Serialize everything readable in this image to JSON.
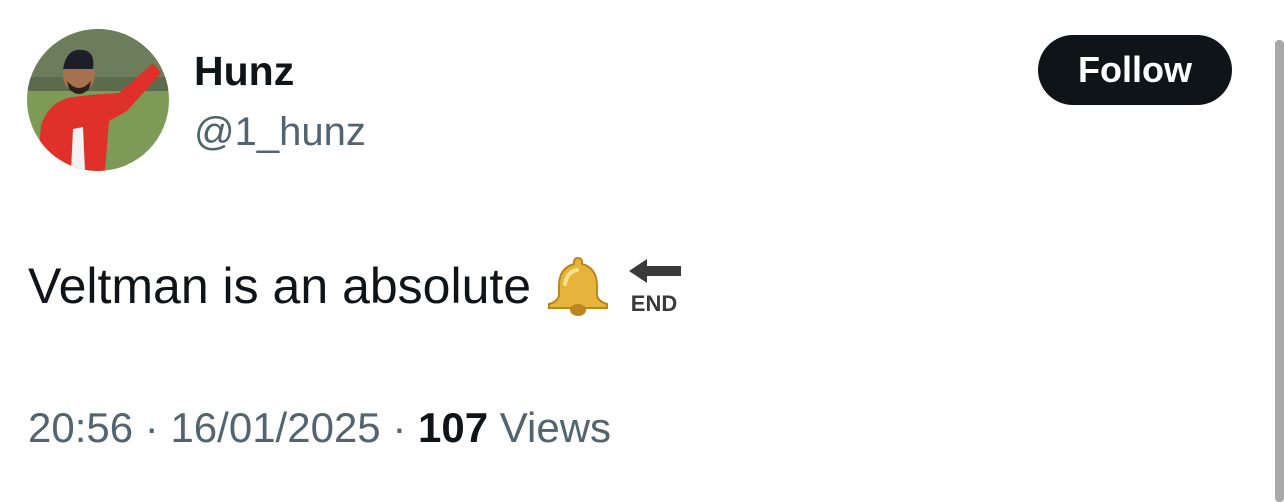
{
  "author": {
    "display_name": "Hunz",
    "handle": "@1_hunz"
  },
  "follow_button": {
    "label": "Follow"
  },
  "tweet": {
    "text": "Veltman is an absolute",
    "emojis": [
      "bell-emoji",
      "end-arrow-emoji"
    ],
    "end_emoji_text": "END"
  },
  "meta": {
    "time": "20:56",
    "separator": "·",
    "date": "16/01/2025",
    "views_count": "107",
    "views_label": "Views"
  },
  "colors": {
    "text_primary": "#0f1419",
    "text_secondary": "#536471",
    "button_bg": "#0f1419",
    "background": "#ffffff"
  }
}
